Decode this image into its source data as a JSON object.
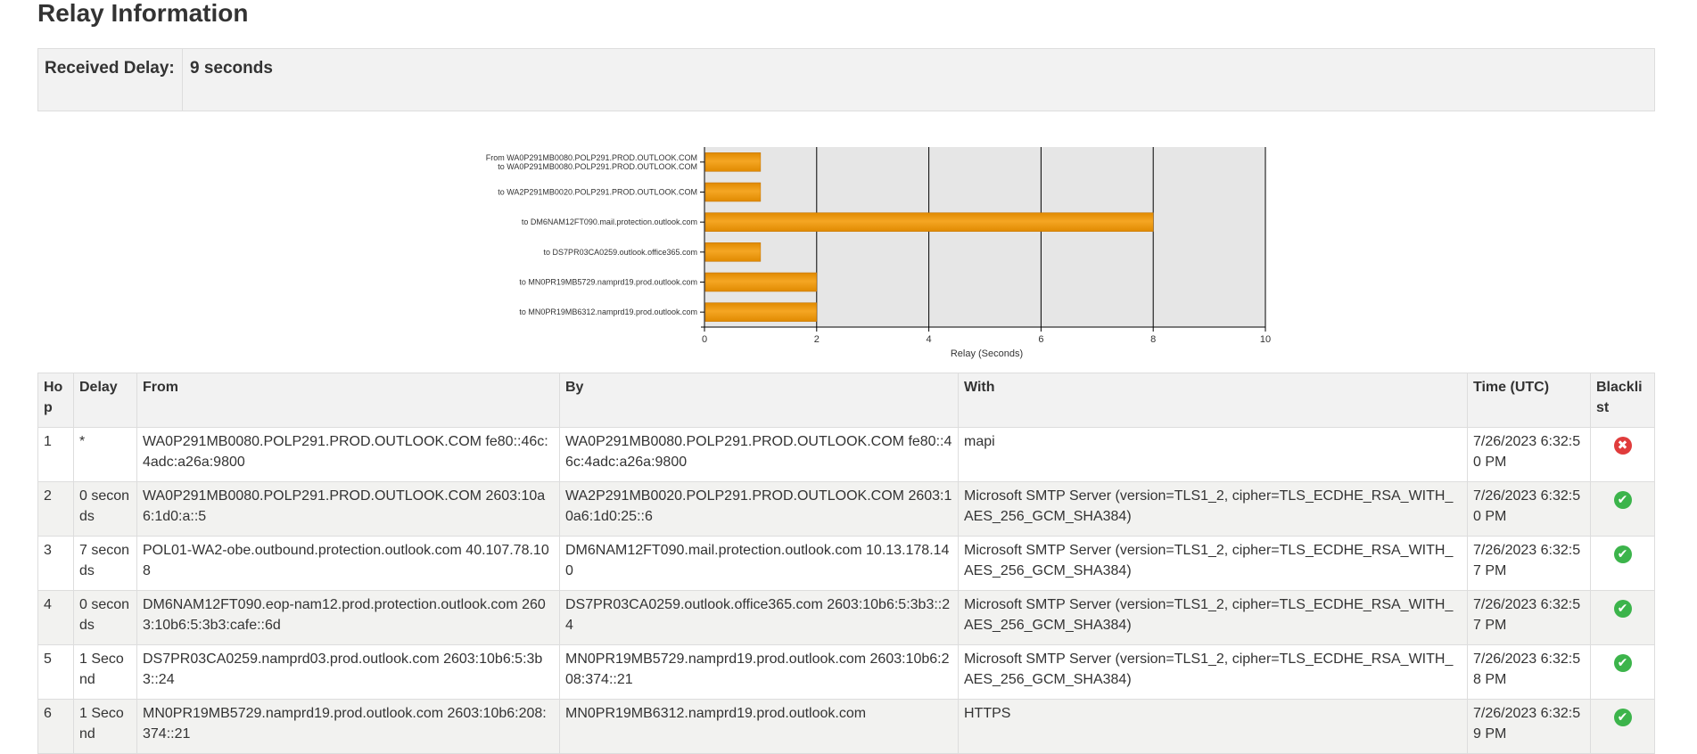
{
  "page": {
    "title": "Relay Information"
  },
  "received_delay": {
    "label": "Received Delay:",
    "value": "9 seconds"
  },
  "chart_data": {
    "type": "bar",
    "orientation": "horizontal",
    "categories": [
      [
        "From WA0P291MB0080.POLP291.PROD.OUTLOOK.COM",
        "to WA0P291MB0080.POLP291.PROD.OUTLOOK.COM"
      ],
      [
        "to WA2P291MB0020.POLP291.PROD.OUTLOOK.COM"
      ],
      [
        "to DM6NAM12FT090.mail.protection.outlook.com"
      ],
      [
        "to DS7PR03CA0259.outlook.office365.com"
      ],
      [
        "to MN0PR19MB5729.namprd19.prod.outlook.com"
      ],
      [
        "to MN0PR19MB6312.namprd19.prod.outlook.com"
      ]
    ],
    "values": [
      1,
      1,
      8,
      1,
      2,
      2
    ],
    "xlabel": "Relay (Seconds)",
    "xlim": [
      0,
      10
    ],
    "xticks": [
      0,
      2,
      4,
      6,
      8,
      10
    ],
    "grid": true,
    "colors": {
      "bar": "#f5a623",
      "bar_dark": "#e08a00",
      "plot_bg": "#e6e6e6"
    }
  },
  "table": {
    "headers": [
      "Hop",
      "Delay",
      "From",
      "By",
      "With",
      "Time (UTC)",
      "Blacklist"
    ],
    "rows": [
      {
        "hop": "1",
        "delay": "*",
        "from": "WA0P291MB0080.POLP291.PROD.OUTLOOK.COM fe80::46c:4adc:a26a:9800",
        "by": "WA0P291MB0080.POLP291.PROD.OUTLOOK.COM fe80::46c:4adc:a26a:9800",
        "with": "mapi",
        "time": "7/26/2023 6:32:50 PM",
        "blacklist": "fail"
      },
      {
        "hop": "2",
        "delay": "0 seconds",
        "from": "WA0P291MB0080.POLP291.PROD.OUTLOOK.COM 2603:10a6:1d0:a::5",
        "by": "WA2P291MB0020.POLP291.PROD.OUTLOOK.COM 2603:10a6:1d0:25::6",
        "with": "Microsoft SMTP Server (version=TLS1_2, cipher=TLS_ECDHE_RSA_WITH_AES_256_GCM_SHA384)",
        "time": "7/26/2023 6:32:50 PM",
        "blacklist": "pass"
      },
      {
        "hop": "3",
        "delay": "7 seconds",
        "from": "POL01-WA2-obe.outbound.protection.outlook.com 40.107.78.108",
        "by": "DM6NAM12FT090.mail.protection.outlook.com 10.13.178.140",
        "with": "Microsoft SMTP Server (version=TLS1_2, cipher=TLS_ECDHE_RSA_WITH_AES_256_GCM_SHA384)",
        "time": "7/26/2023 6:32:57 PM",
        "blacklist": "pass"
      },
      {
        "hop": "4",
        "delay": "0 seconds",
        "from": "DM6NAM12FT090.eop-nam12.prod.protection.outlook.com 2603:10b6:5:3b3:cafe::6d",
        "by": "DS7PR03CA0259.outlook.office365.com 2603:10b6:5:3b3::24",
        "with": "Microsoft SMTP Server (version=TLS1_2, cipher=TLS_ECDHE_RSA_WITH_AES_256_GCM_SHA384)",
        "time": "7/26/2023 6:32:57 PM",
        "blacklist": "pass"
      },
      {
        "hop": "5",
        "delay": "1 Second",
        "from": "DS7PR03CA0259.namprd03.prod.outlook.com 2603:10b6:5:3b3::24",
        "by": "MN0PR19MB5729.namprd19.prod.outlook.com 2603:10b6:208:374::21",
        "with": "Microsoft SMTP Server (version=TLS1_2, cipher=TLS_ECDHE_RSA_WITH_AES_256_GCM_SHA384)",
        "time": "7/26/2023 6:32:58 PM",
        "blacklist": "pass"
      },
      {
        "hop": "6",
        "delay": "1 Second",
        "from": "MN0PR19MB5729.namprd19.prod.outlook.com 2603:10b6:208:374::21",
        "by": "MN0PR19MB6312.namprd19.prod.outlook.com",
        "with": "HTTPS",
        "time": "7/26/2023 6:32:59 PM",
        "blacklist": "pass"
      }
    ],
    "status_icons": {
      "pass": {
        "glyph": "✔",
        "color": "#3cb44b",
        "name": "check-circle-icon"
      },
      "fail": {
        "glyph": "✖",
        "color": "#e03c3c",
        "name": "x-circle-icon"
      }
    }
  }
}
